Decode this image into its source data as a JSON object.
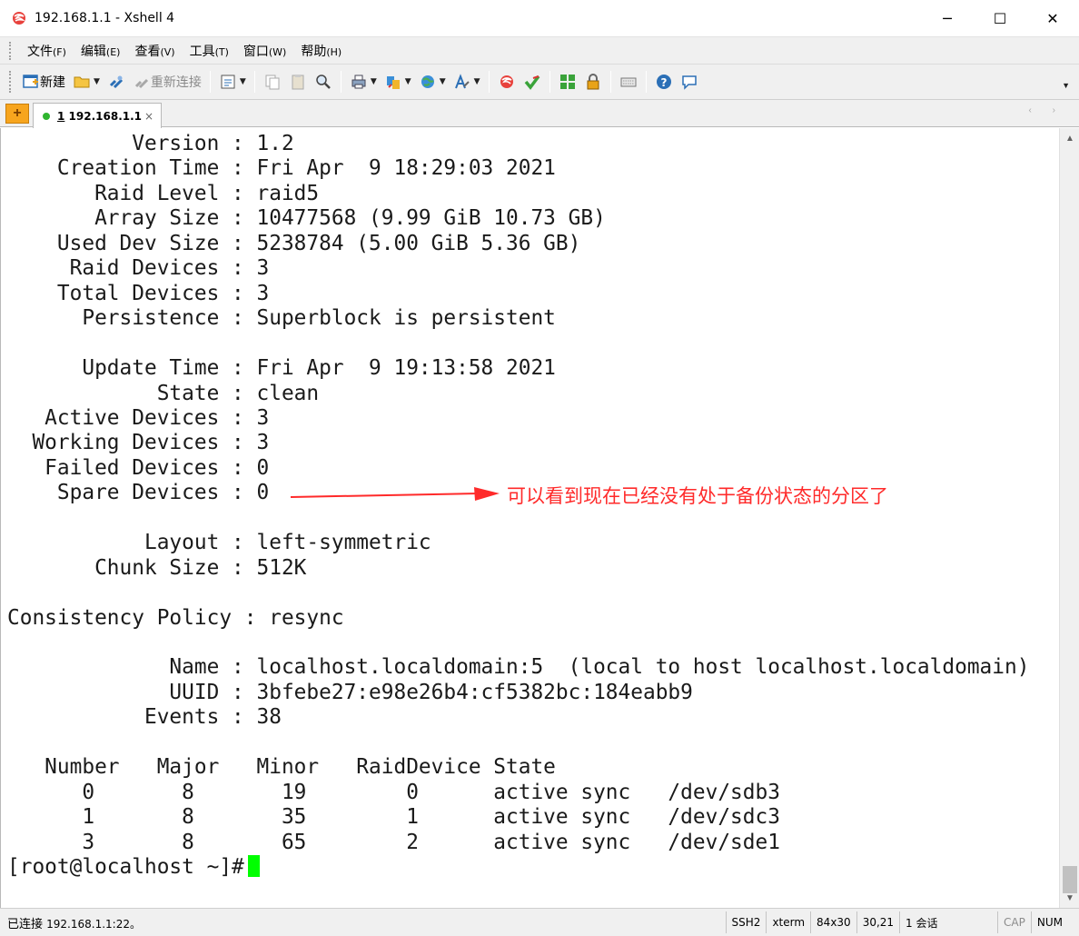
{
  "window": {
    "title": "192.168.1.1 - Xshell 4",
    "icon": "xshell-logo-icon",
    "controls": {
      "minimize": "─",
      "maximize": "☐",
      "close": "✕"
    }
  },
  "menu": [
    {
      "label": "文件",
      "hotkey": "(F)"
    },
    {
      "label": "编辑",
      "hotkey": "(E)"
    },
    {
      "label": "查看",
      "hotkey": "(V)"
    },
    {
      "label": "工具",
      "hotkey": "(T)"
    },
    {
      "label": "窗口",
      "hotkey": "(W)"
    },
    {
      "label": "帮助",
      "hotkey": "(H)"
    }
  ],
  "toolbar": {
    "new_label": "新建",
    "reconnect_label": "重新连接"
  },
  "tabs": {
    "add_icon": "plus-icon",
    "items": [
      {
        "number": "1",
        "host": "192.168.1.1",
        "close": "×",
        "status_color": "#2fb52f"
      }
    ],
    "nav_glyphs": "‹ ›"
  },
  "terminal": {
    "lines": [
      "          Version : 1.2",
      "    Creation Time : Fri Apr  9 18:29:03 2021",
      "       Raid Level : raid5",
      "       Array Size : 10477568 (9.99 GiB 10.73 GB)",
      "    Used Dev Size : 5238784 (5.00 GiB 5.36 GB)",
      "     Raid Devices : 3",
      "    Total Devices : 3",
      "      Persistence : Superblock is persistent",
      "",
      "      Update Time : Fri Apr  9 19:13:58 2021",
      "            State : clean",
      "   Active Devices : 3",
      "  Working Devices : 3",
      "   Failed Devices : 0",
      "    Spare Devices : 0",
      "",
      "           Layout : left-symmetric",
      "       Chunk Size : 512K",
      "",
      "Consistency Policy : resync",
      "",
      "             Name : localhost.localdomain:5  (local to host localhost.localdomain)",
      "             UUID : 3bfebe27:e98e26b4:cf5382bc:184eabb9",
      "           Events : 38",
      "",
      "   Number   Major   Minor   RaidDevice State",
      "      0       8       19        0      active sync   /dev/sdb3",
      "      1       8       35        1      active sync   /dev/sdc3",
      "      3       8       65        2      active sync   /dev/sde1"
    ],
    "prompt": "[root@localhost ~]# ",
    "cursor_color": "#00ff00"
  },
  "annotation": {
    "text": "可以看到现在已经没有处于备份状态的分区了",
    "color": "#ff2a2a"
  },
  "statusbar": {
    "connection_label": "已连接",
    "address": "192.168.1.1:22。",
    "protocol": "SSH2",
    "terminal_type": "xterm",
    "size": "84x30",
    "cursor_pos": "30,21",
    "sessions": "1 会话",
    "cap": "CAP",
    "num": "NUM"
  }
}
